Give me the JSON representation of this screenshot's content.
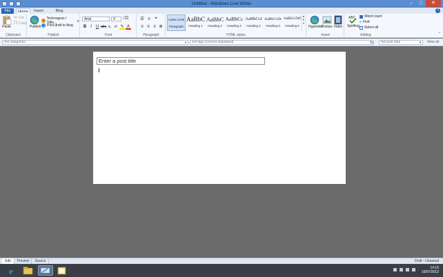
{
  "window": {
    "title": "Untitled - Windows Live Writer"
  },
  "tabs": {
    "file": "File",
    "home": "Home",
    "insert": "Insert",
    "blog_account": "Blog Account"
  },
  "ribbon": {
    "clipboard": {
      "paste": "Paste",
      "cut": "Cut",
      "copy": "Copy",
      "label": "Clipboard"
    },
    "publish": {
      "publish": "Publish",
      "blog_name": "Technogran / Tittle...",
      "post_draft": "Post draft to blog",
      "label": "Publish"
    },
    "font": {
      "family": "Arial",
      "size": "9",
      "label": "Font"
    },
    "paragraph": {
      "label": "Paragraph"
    },
    "html_styles": {
      "label": "HTML styles",
      "items": [
        {
          "sample": "AaBbCcDdE",
          "name": "Paragraph"
        },
        {
          "sample": "AaBbC",
          "name": "Heading 1"
        },
        {
          "sample": "AaBbC",
          "name": "Heading 2"
        },
        {
          "sample": "AaBbCc",
          "name": "Heading 3"
        },
        {
          "sample": "AaBbCcI",
          "name": "Heading 4"
        },
        {
          "sample": "AaBbCcDr",
          "name": "Heading 5"
        },
        {
          "sample": "AaBbCcDdI",
          "name": "Heading 6"
        }
      ]
    },
    "insert": {
      "hyperlink": "Hyperlink",
      "picture": "Picture",
      "video": "Video",
      "label": "Insert"
    },
    "editing": {
      "spelling": "Spelling",
      "word_count": "Word count",
      "find": "Find",
      "select_all": "Select all",
      "label": "Editing"
    }
  },
  "properties": {
    "categories_placeholder": "Set categories",
    "tags_placeholder": "Set tags (comma separated)",
    "post_date_placeholder": "Set post date",
    "view_all": "View all"
  },
  "editor": {
    "title_placeholder": "Enter a post title"
  },
  "view_tabs": {
    "edit": "Edit",
    "preview": "Preview",
    "source": "Source"
  },
  "status": "Draft - Unsaved",
  "taskbar": {
    "time": "14:16",
    "date": "16/07/2012"
  },
  "colors": {
    "accent": "#2b63b6",
    "titlebar": "#5a8ed0",
    "canvas": "#6b6b6b"
  }
}
